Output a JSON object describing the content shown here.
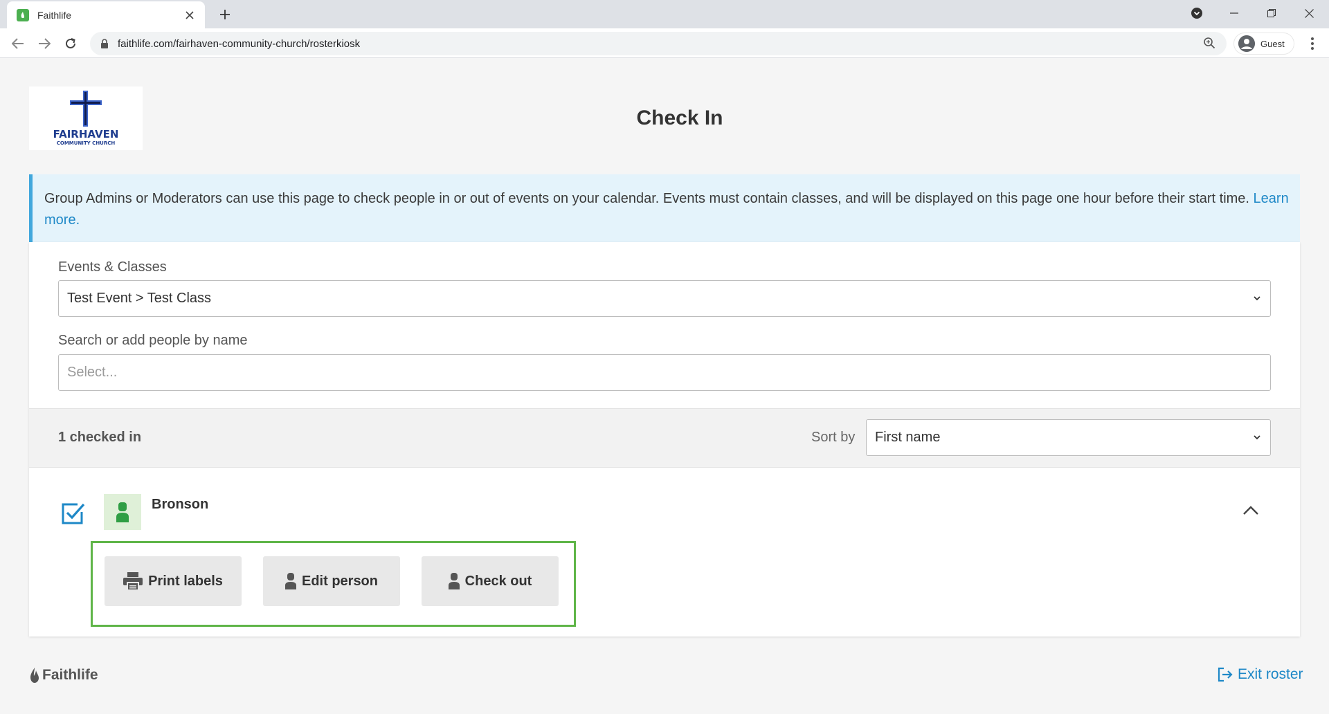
{
  "browser": {
    "tab_title": "Faithlife",
    "url": "faithlife.com/fairhaven-community-church/rosterkiosk",
    "profile_label": "Guest"
  },
  "logo": {
    "name": "FAIRHAVEN",
    "subtitle": "COMMUNITY CHURCH",
    "color": "#1f3d8f"
  },
  "page": {
    "title": "Check In",
    "info_text": "Group Admins or Moderators can use this page to check people in or out of events on your calendar. Events must contain classes, and will be displayed on this page one hour before their start time. ",
    "info_link": "Learn more."
  },
  "form": {
    "events_label": "Events & Classes",
    "events_value": "Test Event > Test Class",
    "search_label": "Search or add people by name",
    "search_placeholder": "Select..."
  },
  "list": {
    "checked_count": "1 checked in",
    "sort_label": "Sort by",
    "sort_value": "First name",
    "people": [
      {
        "name": "Bronson",
        "checked": true,
        "actions": [
          {
            "label": "Print labels",
            "icon": "printer-icon"
          },
          {
            "label": "Edit person",
            "icon": "person-icon"
          },
          {
            "label": "Check out",
            "icon": "person-icon"
          }
        ]
      }
    ]
  },
  "footer": {
    "brand": "Faithlife",
    "exit_label": "Exit roster"
  },
  "colors": {
    "accent": "#1e88c7",
    "highlight_outline": "#5fb548",
    "banner_bg": "#e4f3fb",
    "avatar_bg": "#dff0d8"
  }
}
